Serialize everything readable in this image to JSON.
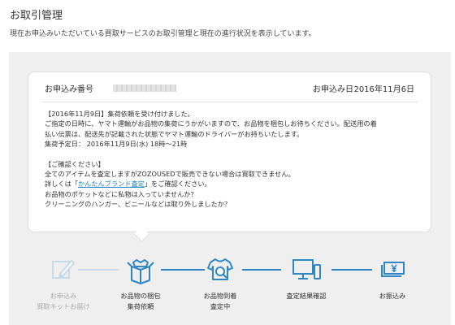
{
  "page": {
    "title": "お取引管理",
    "description": "現在お申込みいただいている買取サービスのお取引管理と現在の進行状況を表示しています。"
  },
  "order": {
    "number_label": "お申込み番号",
    "date_label": "お申込み日",
    "date_value": "2016年11月6日"
  },
  "message": {
    "line1": "【2016年11月9日】集荷依頼を受け付けました。",
    "line2": "ご指定の日時に、ヤマト運輸がお品物の集荷にうかがいますので、お品物を梱包しお待ちください。配送用の着",
    "line3": "払い伝票は、配送先が記載された状態でヤマト運輸のドライバーがお持ちいたします。",
    "line4": "集荷予定日： 2016年11月9日(水) 18時～21時"
  },
  "confirm": {
    "heading": "【ご確認ください】",
    "line1": "全てのアイテムを査定しますがZOZOUSEDで販売できない場合は買取できません。",
    "line2_before": "詳しくは「",
    "link_text": "かんたんブランド査定",
    "line2_after": "」をご確認ください。",
    "line3": "お品物のポケットなどに私物は入っていませんか？",
    "line4": "クリーニングのハンガー、ビニールなどは取り外しましたか？"
  },
  "steps": [
    {
      "line1": "お申込み",
      "line2": "買取キットお届け",
      "icon": "pencil-icon",
      "state": "done"
    },
    {
      "line1": "お品物の梱包",
      "line2": "集荷依頼",
      "icon": "box-icon",
      "state": "current"
    },
    {
      "line1": "お品物到着",
      "line2": "査定中",
      "icon": "shirt-search-icon",
      "state": "upcoming"
    },
    {
      "line1": "査定結果確認",
      "line2": "",
      "icon": "computer-icon",
      "state": "upcoming"
    },
    {
      "line1": "お振込み",
      "line2": "",
      "icon": "yen-money-icon",
      "state": "upcoming"
    }
  ],
  "colors": {
    "accent": "#2f86c4",
    "link": "#1a83c6",
    "done": "#c6d9e8",
    "background": "#efefef"
  }
}
